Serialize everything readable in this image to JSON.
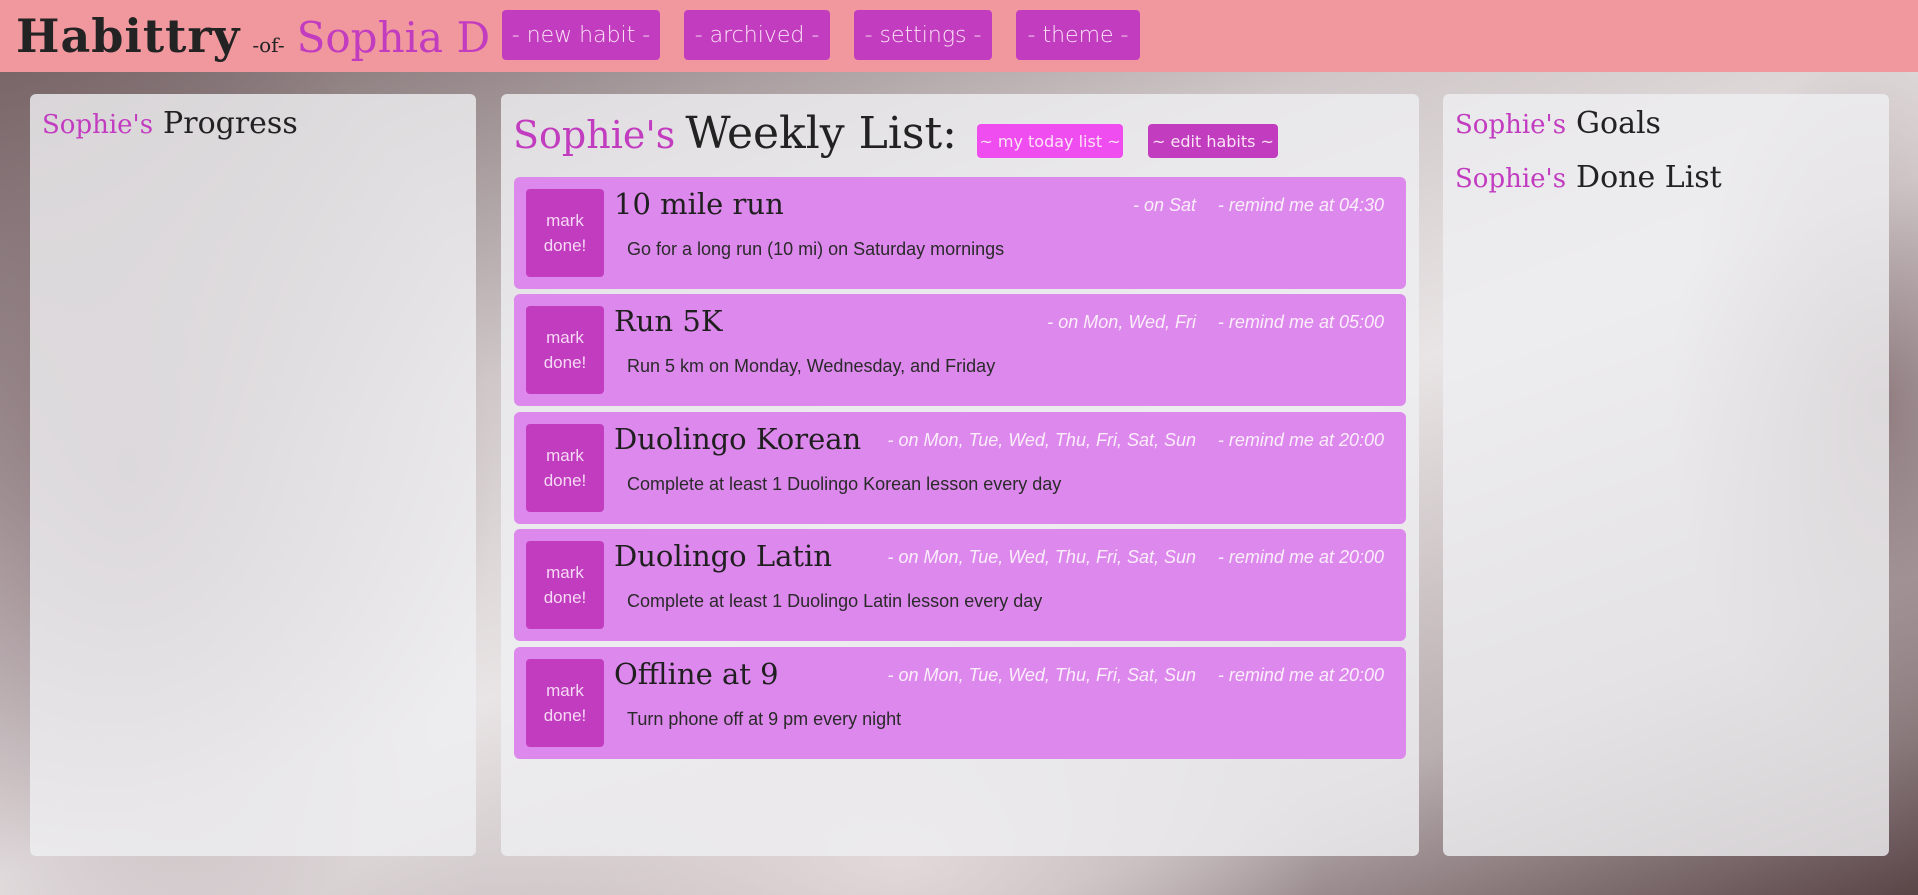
{
  "header": {
    "app_name": "Habittry",
    "of_label": "-of-",
    "user_name": "Sophia D",
    "nav": [
      {
        "label": "- new habit -"
      },
      {
        "label": "- archived -"
      },
      {
        "label": "- settings -"
      },
      {
        "label": "- theme -"
      }
    ]
  },
  "progress_panel": {
    "owner": "Sophie's",
    "title": "Progress"
  },
  "weekly_panel": {
    "owner": "Sophie's",
    "title": "Weekly List:",
    "today_button": "~ my today list ~",
    "edit_button": "~ edit habits ~",
    "habits": [
      {
        "mark": [
          "mark",
          "done!"
        ],
        "title": "10 mile run",
        "days": "- on Sat",
        "remind": "- remind me at 04:30",
        "desc": "Go for a long run (10 mi) on Saturday mornings"
      },
      {
        "mark": [
          "mark",
          "done!"
        ],
        "title": "Run 5K",
        "days": "- on Mon, Wed, Fri",
        "remind": "- remind me at 05:00",
        "desc": "Run 5 km on Monday, Wednesday, and Friday"
      },
      {
        "mark": [
          "mark",
          "done!"
        ],
        "title": "Duolingo Korean",
        "days": "- on Mon, Tue, Wed, Thu, Fri, Sat, Sun",
        "remind": "- remind me at 20:00",
        "desc": "Complete at least 1 Duolingo Korean lesson every day"
      },
      {
        "mark": [
          "mark",
          "done!"
        ],
        "title": "Duolingo Latin",
        "days": "- on Mon, Tue, Wed, Thu, Fri, Sat, Sun",
        "remind": "- remind me at 20:00",
        "desc": "Complete at least 1 Duolingo Latin lesson every day"
      },
      {
        "mark": [
          "mark",
          "done!"
        ],
        "title": "Offline at 9",
        "days": "- on Mon, Tue, Wed, Thu, Fri, Sat, Sun",
        "remind": "- remind me at 20:00",
        "desc": "Turn phone off at 9 pm every night"
      }
    ]
  },
  "goals_panel": {
    "owner": "Sophie's",
    "title": "Goals"
  },
  "done_panel": {
    "owner": "Sophie's",
    "title": "Done List",
    "stray_mark": "ˎ"
  },
  "colors": {
    "accent": "#c23cc0",
    "header_bg": "#f0989e",
    "habit_bg": "#dd88ed",
    "today_button": "#f04df0"
  }
}
